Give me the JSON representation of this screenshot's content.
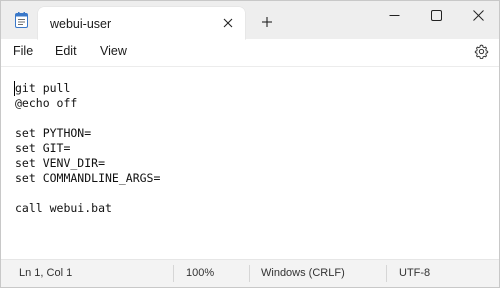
{
  "tab": {
    "title": "webui-user"
  },
  "icons": {
    "app": "notepad-icon",
    "close_tab": "close-icon",
    "new_tab": "plus-icon",
    "minimize": "minimize-icon",
    "maximize": "maximize-icon",
    "close_window": "close-icon",
    "settings": "gear-icon"
  },
  "menu": {
    "file": "File",
    "edit": "Edit",
    "view": "View"
  },
  "editor": {
    "content": "git pull\n@echo off\n\nset PYTHON=\nset GIT=\nset VENV_DIR=\nset COMMANDLINE_ARGS=\n\ncall webui.bat"
  },
  "status": {
    "position": "Ln 1, Col 1",
    "zoom": "100%",
    "line_ending": "Windows (CRLF)",
    "encoding": "UTF-8"
  }
}
